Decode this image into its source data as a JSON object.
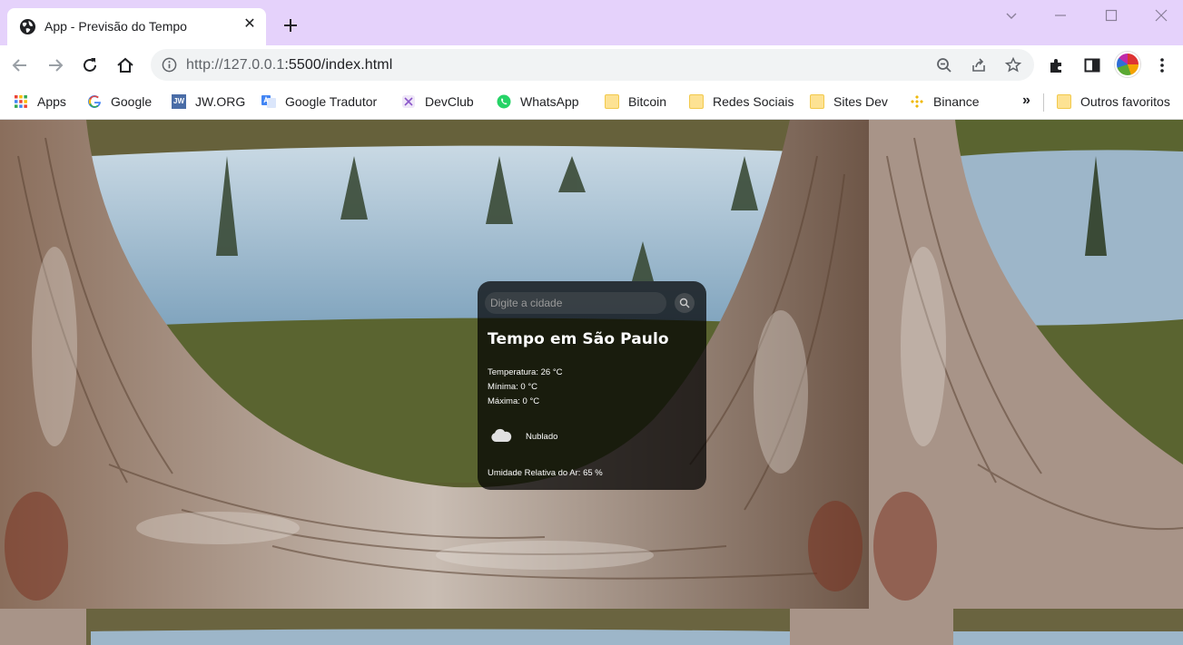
{
  "browser": {
    "tab": {
      "title": "App - Previsão do Tempo",
      "close": "✕"
    },
    "url": {
      "host": "http://127.0.0.1",
      "rest": ":5500/index.html"
    },
    "bookmarks": [
      {
        "label": "Apps",
        "icon": "apps-grid-icon"
      },
      {
        "label": "Google",
        "icon": "google-icon"
      },
      {
        "label": "JW.ORG",
        "icon": "jw-icon"
      },
      {
        "label": "Google Tradutor",
        "icon": "translate-icon"
      },
      {
        "label": "DevClub",
        "icon": "devclub-icon"
      },
      {
        "label": "WhatsApp",
        "icon": "whatsapp-icon"
      },
      {
        "label": "Bitcoin",
        "icon": "folder-icon"
      },
      {
        "label": "Redes Sociais",
        "icon": "folder-icon"
      },
      {
        "label": "Sites Dev",
        "icon": "folder-icon"
      },
      {
        "label": "Binance",
        "icon": "binance-icon"
      }
    ],
    "more": "»",
    "other_bookmarks": "Outros favoritos",
    "jw_icon_text": "JW"
  },
  "weather": {
    "search_placeholder": "Digite a cidade",
    "city_title": "Tempo em São Paulo",
    "temperature": "Temperatura: 26 °C",
    "min": "Mínima: 0 °C",
    "max": "Máxima: 0 °C",
    "icon": "cloud-icon",
    "description": "Nublado",
    "humidity": "Umidade Relativa do Ar: 65 %"
  },
  "colors": {
    "tabstrip": "#e5d2fb",
    "card_bg": "rgba(0,0,0,0.72)"
  }
}
